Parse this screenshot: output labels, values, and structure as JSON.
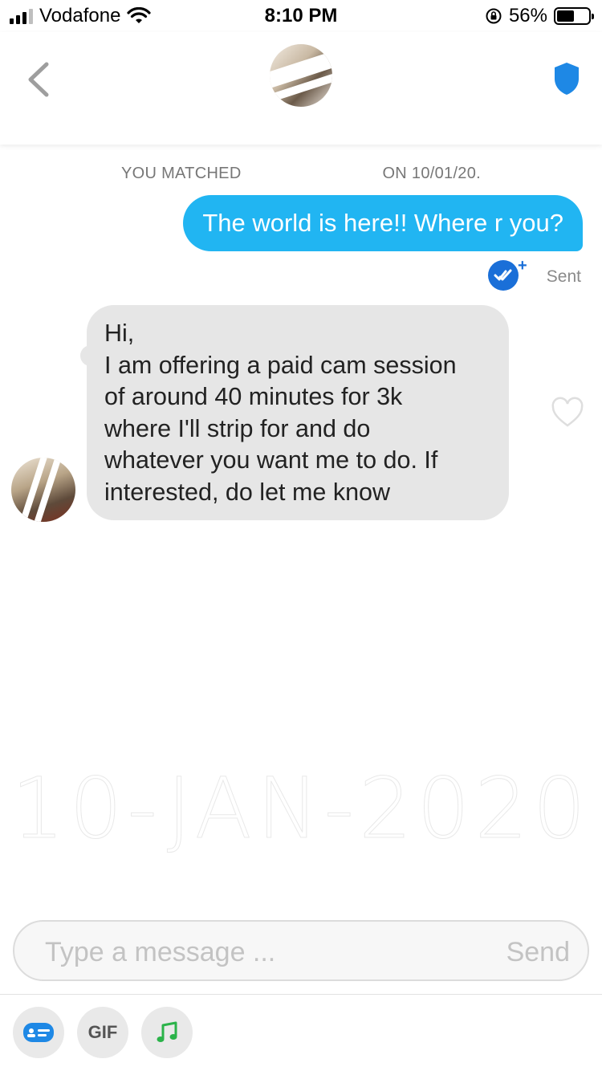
{
  "status_bar": {
    "carrier": "Vodafone",
    "time": "8:10 PM",
    "battery_percent": "56%",
    "battery_level": 0.56
  },
  "header": {
    "back_icon": "chevron-left-icon",
    "safety_icon": "shield-icon",
    "accent_color": "#21b5f2"
  },
  "chat": {
    "match_prefix": "YOU MATCHED ",
    "match_suffix": "ON 10/01/20.",
    "messages": [
      {
        "direction": "out",
        "text": "The world is here!! Where r you?",
        "status": "Sent"
      },
      {
        "direction": "in",
        "lines": [
          "Hi,",
          "I am offering a paid cam session",
          "of around 40 minutes for 3k",
          "where I'll strip for and do",
          "whatever you want me to do. If",
          "interested, do let me know"
        ]
      }
    ],
    "watermark": "10-JAN-2020"
  },
  "composer": {
    "placeholder": "Type a message ...",
    "send_label": "Send"
  },
  "toolbar": {
    "gif_label": "GIF",
    "items": [
      "sticker-card-icon",
      "gif-icon",
      "music-note-icon"
    ]
  }
}
